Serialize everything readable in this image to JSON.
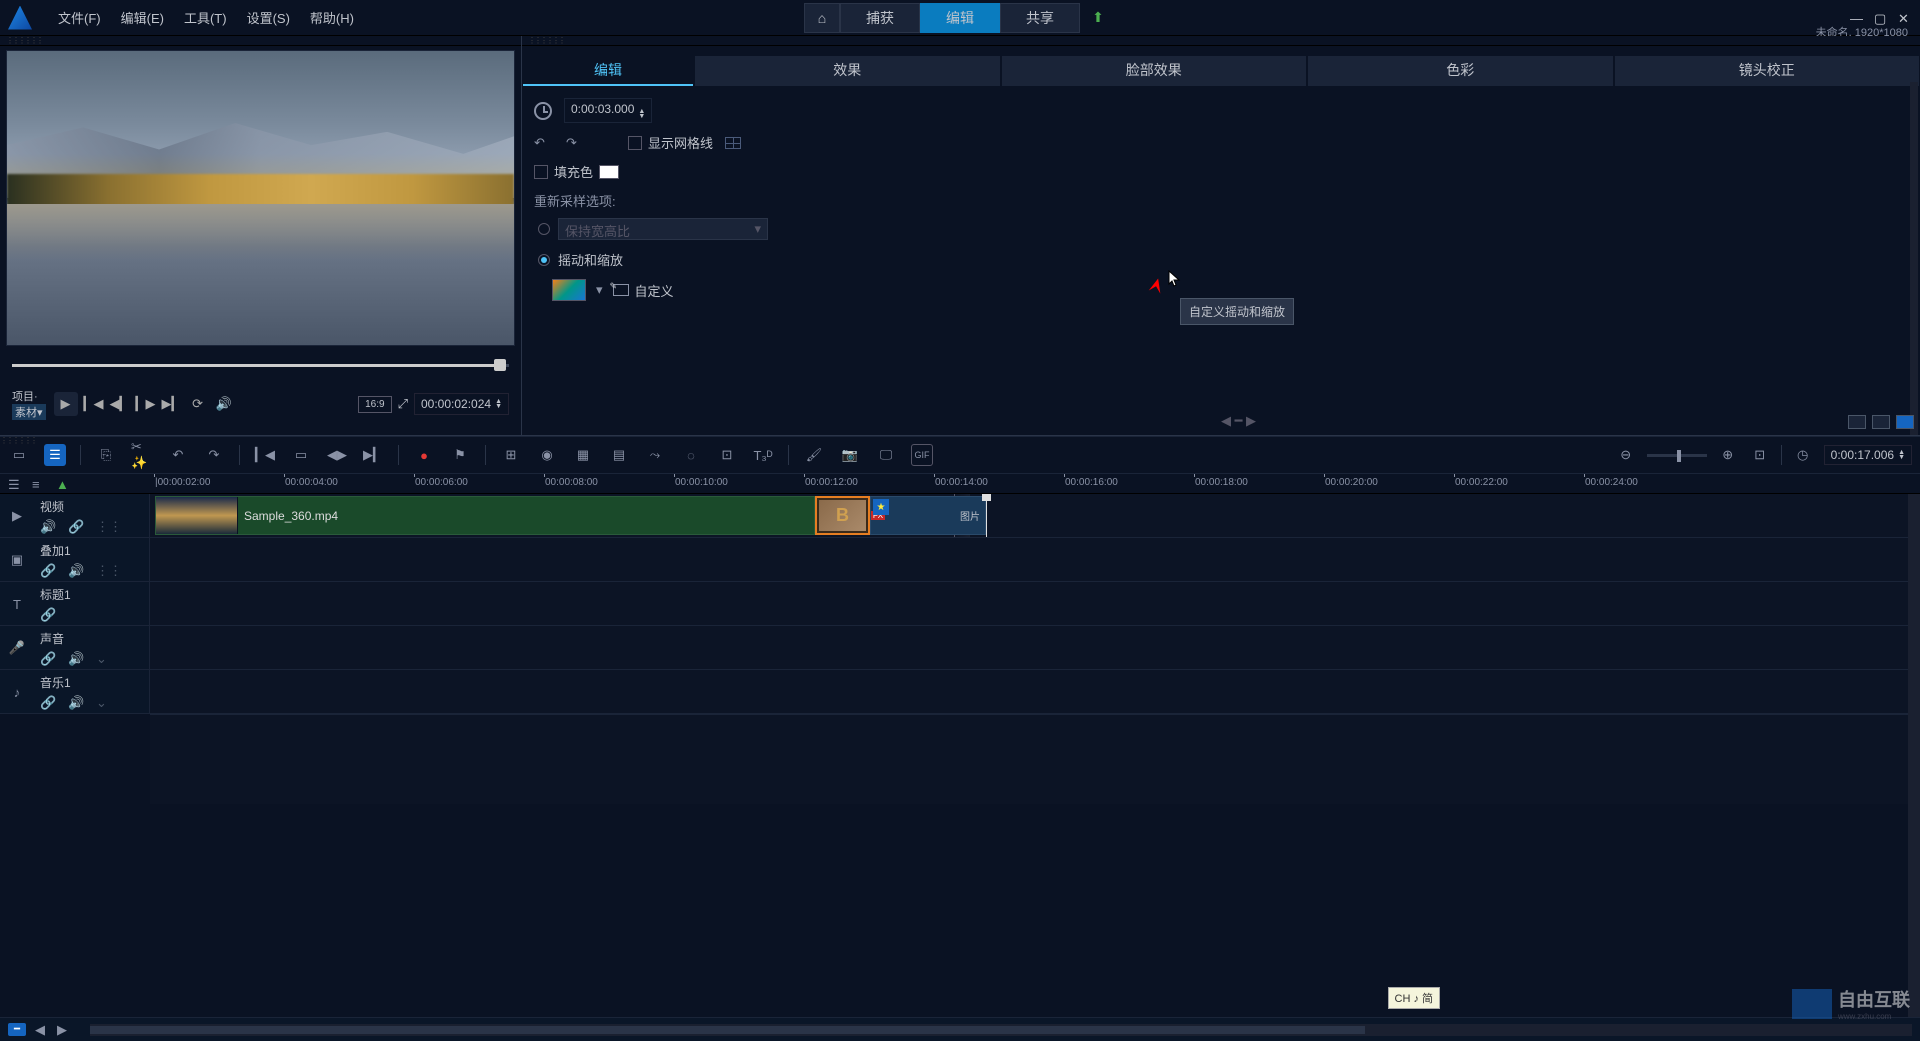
{
  "menubar": {
    "file": "文件(F)",
    "edit": "编辑(E)",
    "tools": "工具(T)",
    "settings": "设置(S)",
    "help": "帮助(H)"
  },
  "top_tabs": {
    "home": "⌂",
    "capture": "捕获",
    "edit": "编辑",
    "share": "共享"
  },
  "project": {
    "title": "未命名, 1920*1080"
  },
  "preview": {
    "mode_project": "项目·",
    "mode_clip": "素材▾",
    "timecode": "00:00:02:024",
    "aspect": "16:9"
  },
  "panel_tabs": {
    "edit": "编辑",
    "effect": "效果",
    "face": "脸部效果",
    "color": "色彩",
    "lens": "镜头校正"
  },
  "panel": {
    "duration": "0:00:03.000",
    "show_grid": "显示网格线",
    "fill_color": "填充色",
    "resample_label": "重新采样选项:",
    "keep_aspect": "保持宽高比",
    "pan_zoom": "摇动和缩放",
    "custom": "自定义",
    "tooltip": "自定义摇动和缩放"
  },
  "timeline": {
    "timecode": "0:00:17.006",
    "ruler": [
      "|00:00:02:00",
      "00:00:04:00",
      "00:00:06:00",
      "00:00:08:00",
      "00:00:10:00",
      "00:00:12:00",
      "00:00:14:00",
      "00:00:16:00",
      "00:00:18:00",
      "00:00:20:00",
      "00:00:22:00",
      "00:00:24:00"
    ],
    "tracks": {
      "video": "视频",
      "overlay": "叠加1",
      "title": "标题1",
      "voice": "声音",
      "music": "音乐1"
    },
    "clip_video": "Sample_360.mp4",
    "clip_trans": "B",
    "clip_img": "图片",
    "fx_badge": "FX"
  },
  "ime": "CH ♪ 简",
  "watermark": {
    "brand": "自由互联",
    "url": "www.zxhu.com"
  }
}
